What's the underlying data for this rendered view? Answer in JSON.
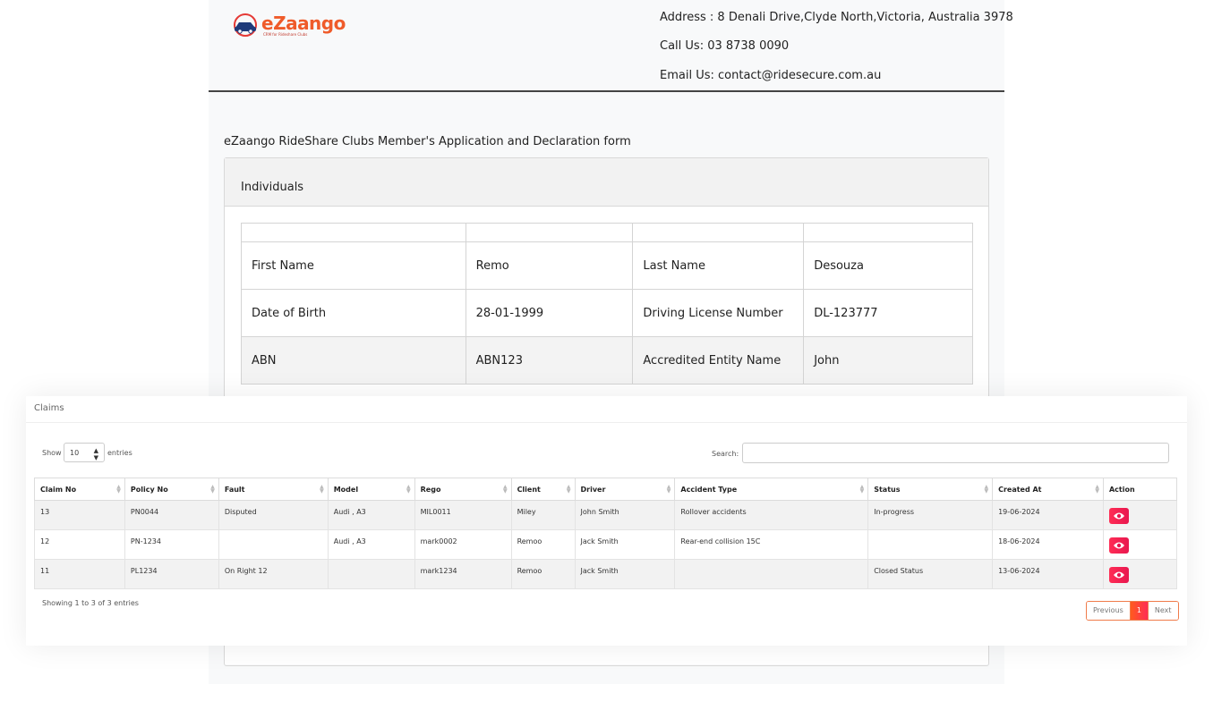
{
  "brand": {
    "name": "eZaango",
    "tagline": "CRM for Rideshare Clubs"
  },
  "header": {
    "address": "Address : 8 Denali Drive,Clyde North,Victoria, Australia 3978",
    "phone": "Call Us: 03 8738 0090",
    "email": "Email Us: contact@ridesecure.com.au"
  },
  "form": {
    "title": "eZaango RideShare Clubs Member's Application and Declaration form",
    "section_title": "Individuals",
    "rows": [
      {
        "label1": "First Name",
        "value1": "Remo",
        "label2": "Last Name",
        "value2": "Desouza"
      },
      {
        "label1": "Date of Birth",
        "value1": "28-01-1999",
        "label2": "Driving License Number",
        "value2": "DL-123777"
      },
      {
        "label1": "ABN",
        "value1": "ABN123",
        "label2": "Accredited Entity Name",
        "value2": "John"
      }
    ]
  },
  "claims": {
    "title": "Claims",
    "show_label": "Show",
    "entries_label": "entries",
    "page_length": "10",
    "search_label": "Search:",
    "search_value": "",
    "columns": [
      "Claim No",
      "Policy No",
      "Fault",
      "Model",
      "Rego",
      "Client",
      "Driver",
      "Accident Type",
      "Status",
      "Created At",
      "Action"
    ],
    "rows": [
      {
        "claim_no": "13",
        "policy_no": "PN0044",
        "fault": "Disputed",
        "model": "Audi , A3",
        "rego": "MIL0011",
        "client": "Miley",
        "driver": "John Smith",
        "accident_type": "Rollover accidents",
        "status": "In-progress",
        "created_at": "19-06-2024"
      },
      {
        "claim_no": "12",
        "policy_no": "PN-1234",
        "fault": "",
        "model": "Audi , A3",
        "rego": "mark0002",
        "client": "Remoo",
        "driver": "Jack Smith",
        "accident_type": "Rear-end collision 15C",
        "status": "",
        "created_at": "18-06-2024"
      },
      {
        "claim_no": "11",
        "policy_no": "PL1234",
        "fault": "On Right 12",
        "model": "",
        "rego": "mark1234",
        "client": "Remoo",
        "driver": "Jack Smith",
        "accident_type": "",
        "status": "Closed Status",
        "created_at": "13-06-2024"
      }
    ],
    "info": "Showing 1 to 3 of 3 entries",
    "pagination": {
      "previous": "Previous",
      "current": "1",
      "next": "Next"
    },
    "action_icon": "eye-icon",
    "accent_color": "#ff2d55"
  }
}
